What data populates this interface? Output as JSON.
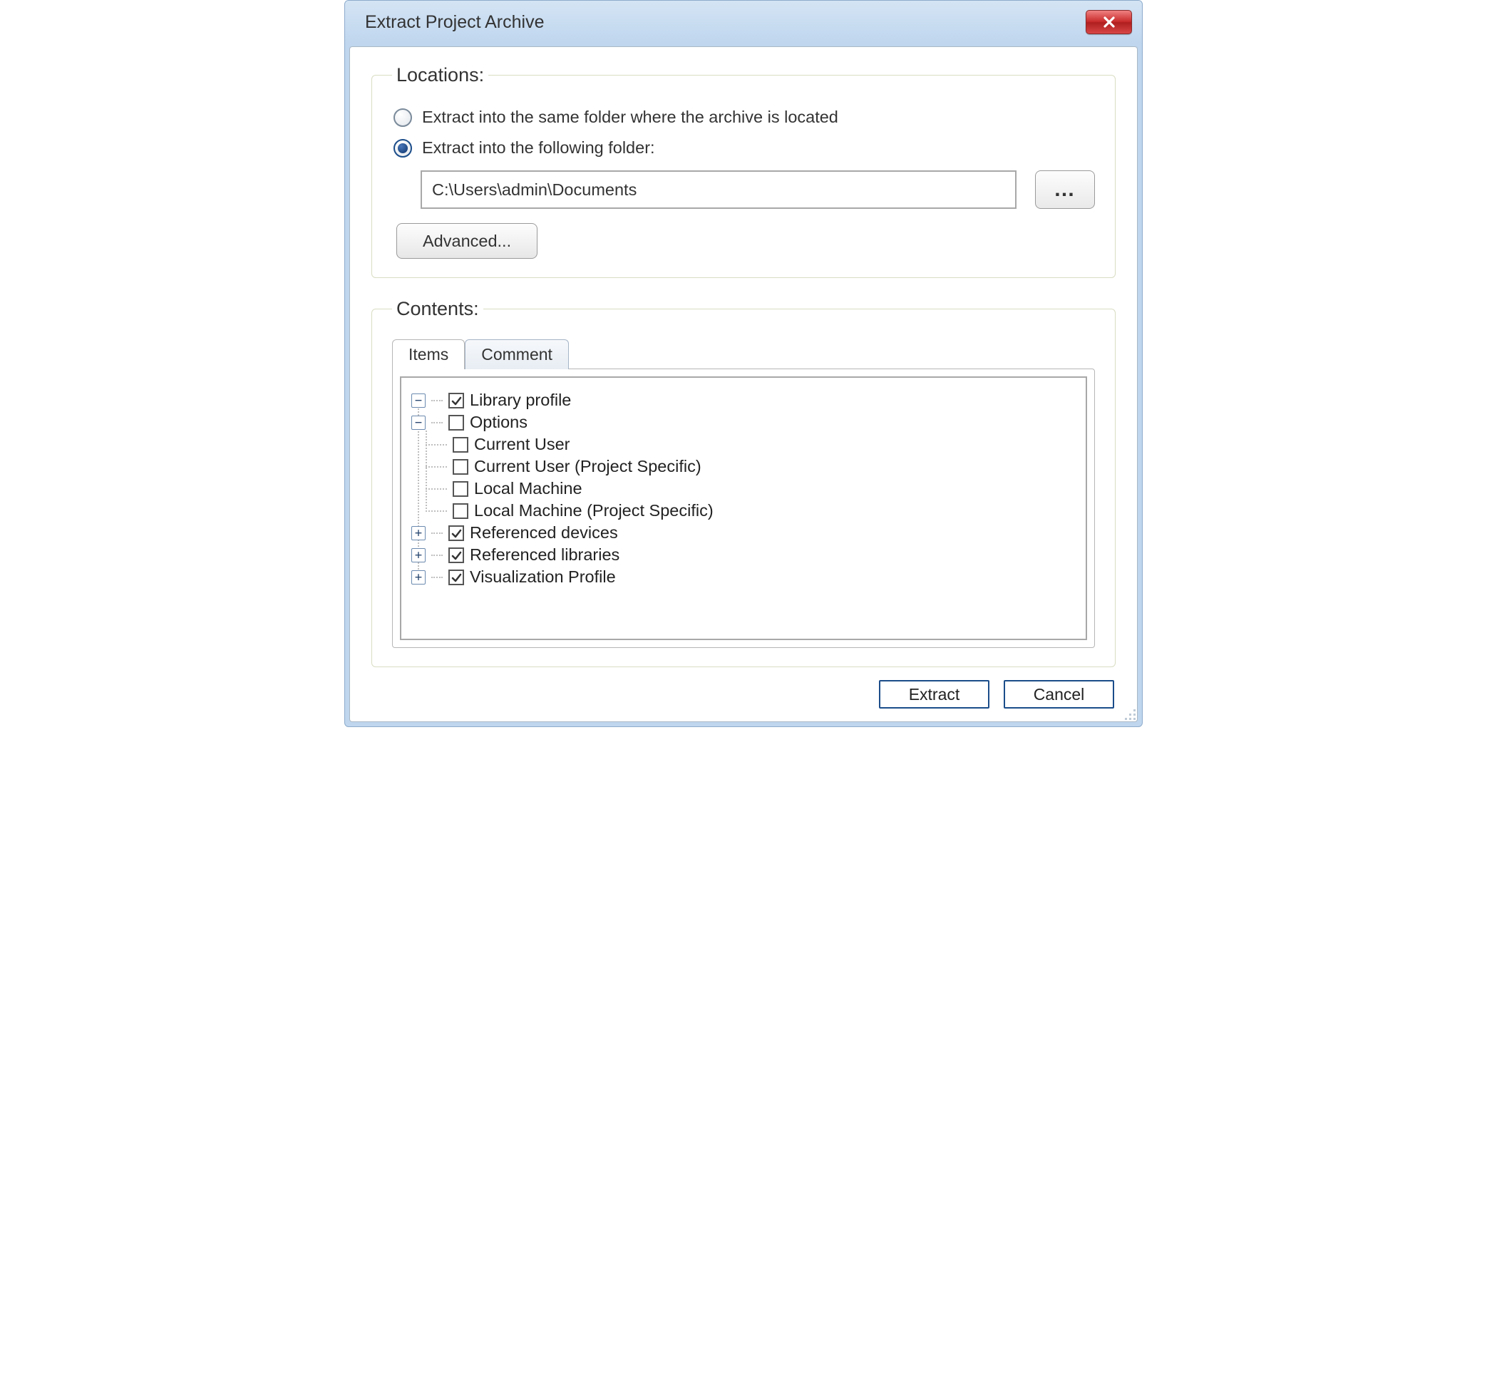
{
  "window": {
    "title": "Extract Project Archive"
  },
  "locations": {
    "legend": "Locations:",
    "option_same": "Extract into the same folder where the archive is located",
    "option_following": "Extract into the following folder:",
    "selected": "following",
    "path_value": "C:\\Users\\admin\\Documents",
    "browse_label": "…",
    "advanced_label": "Advanced..."
  },
  "contents": {
    "legend": "Contents:",
    "tabs": {
      "items": "Items",
      "comment": "Comment",
      "active": "items"
    },
    "tree": {
      "library_profile": {
        "label": "Library profile",
        "checked": true,
        "state": "collapsed_minus"
      },
      "options": {
        "label": "Options",
        "checked": false,
        "state": "expanded",
        "children": {
          "current_user": {
            "label": "Current User",
            "checked": false
          },
          "current_user_ps": {
            "label": "Current User (Project Specific)",
            "checked": false
          },
          "local_machine": {
            "label": "Local Machine",
            "checked": false
          },
          "local_machine_ps": {
            "label": "Local Machine (Project Specific)",
            "checked": false
          }
        }
      },
      "referenced_devices": {
        "label": "Referenced devices",
        "checked": true,
        "state": "collapsed"
      },
      "referenced_libraries": {
        "label": "Referenced libraries",
        "checked": true,
        "state": "collapsed"
      },
      "visualization_profile": {
        "label": "Visualization Profile",
        "checked": true,
        "state": "collapsed"
      }
    }
  },
  "footer": {
    "extract": "Extract",
    "cancel": "Cancel"
  },
  "icons": {
    "close": "close-icon",
    "resize": "resize-grip-icon"
  }
}
